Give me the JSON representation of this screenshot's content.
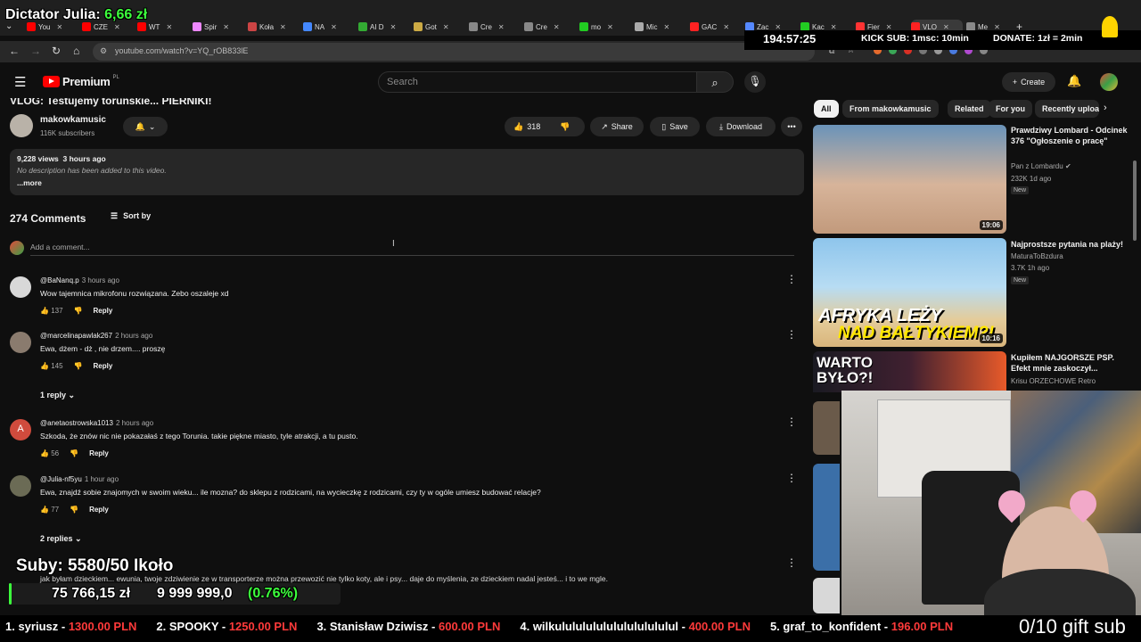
{
  "overlay": {
    "dictator_label": "Dictator Julia: ",
    "dictator_amount": "6,66 zł",
    "timer": "194:57:25",
    "kick_sub": "KICK SUB: 1msc: 10min",
    "donate": "DONATE: 1zł = 2min",
    "subs": "Suby: 5580/50",
    "subs_tail": "Ikoło",
    "money": "75 766,15 zł",
    "goal": "9 999 999,0",
    "goal_pct": "(0.76%)",
    "ticker": [
      {
        "rank": "1. syriusz - ",
        "amount": "1300.00 PLN"
      },
      {
        "rank": "2. SPOOKY - ",
        "amount": "1250.00 PLN"
      },
      {
        "rank": "3. Stanisław Dziwisz - ",
        "amount": "600.00 PLN"
      },
      {
        "rank": "4. wilkulululululululululululul - ",
        "amount": "400.00 PLN"
      },
      {
        "rank": "5. graf_to_konfident - ",
        "amount": "196.00 PLN"
      }
    ],
    "gift_sub": "0/10 gift sub"
  },
  "browser": {
    "tabs": [
      "You",
      "CZE",
      "WT",
      "Spir",
      "Koła",
      "NA",
      "AI D",
      "Got",
      "Cre",
      "Cre",
      "mo",
      "Mic",
      "GAC",
      "Zac",
      "Kac",
      "Fier",
      "VLO",
      "Me"
    ],
    "url": "youtube.com/watch?v=YQ_rOB833lE"
  },
  "youtube": {
    "logo": "Premium",
    "logo_region": "PL",
    "search_placeholder": "Search",
    "create": "Create",
    "video_title": "VLOG: Testujemy toruńskie... PIERNIKI!",
    "channel": "makowkamusic",
    "subscribers": "116K subscribers",
    "likes": "318",
    "share": "Share",
    "save": "Save",
    "download": "Download",
    "views": "9,228 views",
    "uploaded": "3 hours ago",
    "description": "No description has been added to this video.",
    "more": "...more",
    "comments_count": "274 Comments",
    "sort_by": "Sort by",
    "add_comment": "Add a comment...",
    "comments": [
      {
        "handle": "@BaNanq.p",
        "ago": "3 hours ago",
        "text": "Wow tajemnica mikrofonu rozwiązana. Zebo oszaleje xd",
        "likes": "137",
        "reply": "Reply",
        "avatar_color": "#d8d8d8"
      },
      {
        "handle": "@marcelinapawlak267",
        "ago": "2 hours ago",
        "text": "Ewa, dżem - dż , nie drzem.... proszę",
        "likes": "145",
        "reply": "Reply",
        "avatar_color": "#8a7b6e",
        "replies": "1 reply"
      },
      {
        "handle": "@anetaostrowska1013",
        "ago": "2 hours ago",
        "text": "Szkoda, że znów nic nie pokazałaś z tego Torunia. takie piękne miasto, tyle atrakcji, a tu pusto.",
        "likes": "56",
        "reply": "Reply",
        "avatar_color": "#d04b3d",
        "avatar_letter": "A"
      },
      {
        "handle": "@Julia-nf5yu",
        "ago": "1 hour ago",
        "text": "Ewa, znajdź sobie znajomych w swoim wieku... ile mozna? do sklepu z rodzicami, na wycieczkę z rodzicami, czy ty w ogóle umiesz budować relacje?",
        "likes": "77",
        "reply": "Reply",
        "avatar_color": "#6b6b55",
        "replies": "2 replies"
      },
      {
        "text": "jak byłam dzieckiem... ewunia, twoje zdziwienie ze w transporterze można przewozić nie tylko koty, ale i psy... daje do myślenia, ze dzieckiem nadal jesteś... i to we mgle."
      }
    ],
    "chips": [
      "All",
      "From makowkamusic",
      "Related",
      "For you",
      "Recently uploaded"
    ],
    "related": [
      {
        "title": "Prawdziwy Lombard - Odcinek 376 \"Ogłoszenie o pracę\"",
        "channel": "Pan z Lombardu",
        "meta": "232K  1d ago",
        "badge": "New",
        "duration": "19:06"
      },
      {
        "title": "Najprostsze pytania na plaży!",
        "channel": "MaturaToBzdura",
        "meta": "3.7K  1h ago",
        "badge": "New",
        "duration": "10:16",
        "thumb_text_1": "AFRYKA LEŻY",
        "thumb_text_2": "NAD BAŁTYKIEM?!"
      },
      {
        "title": "Kupiłem NAJGORSZE PSP. Efekt mnie zaskoczył...",
        "channel": "Krisu ORZECHOWE Retro",
        "thumb_text_1": "WARTO",
        "thumb_text_2": "BYŁO?!"
      }
    ]
  },
  "colors": {
    "accent": "#ff0000",
    "overlay_green": "#3cff3c",
    "ticker_red": "#ff3a3a"
  }
}
